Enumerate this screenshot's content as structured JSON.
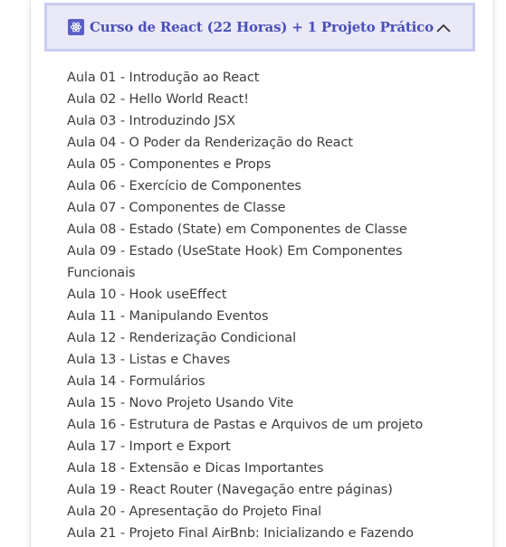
{
  "accordion": {
    "icon": "react-icon",
    "title": "Curso de React (22 Horas) + 1 Projeto Prático",
    "toggle_icon": "chevron-up-icon",
    "expanded": true,
    "accent_color": "#4b50b7",
    "header_background": "#e9e9f8",
    "header_border": "#c9cbf0"
  },
  "lessons": [
    "Aula 01 - Introdução ao React",
    "Aula 02 - Hello World React!",
    "Aula 03 - Introduzindo JSX",
    "Aula 04 - O Poder da Renderização do React",
    "Aula 05 - Componentes e Props",
    "Aula 06 - Exercício de Componentes",
    "Aula 07 - Componentes de Classe",
    "Aula 08 - Estado (State) em Componentes de Classe",
    "Aula 09 - Estado (UseState Hook) Em Componentes Funcionais",
    "Aula 10 - Hook useEffect",
    "Aula 11 - Manipulando Eventos",
    "Aula 12 - Renderização Condicional",
    "Aula 13 - Listas e Chaves",
    "Aula 14 - Formulários",
    "Aula 15 - Novo Projeto Usando Vite",
    "Aula 16 - Estrutura de Pastas e Arquivos de um projeto",
    "Aula 17 - Import e Export",
    "Aula 18 - Extensão e Dicas Importantes",
    "Aula 19 - React Router (Navegação entre páginas)",
    "Aula 20 - Apresentação do Projeto Final",
    "Aula 21 - Projeto Final AirBnb: Inicializando e Fazendo"
  ]
}
